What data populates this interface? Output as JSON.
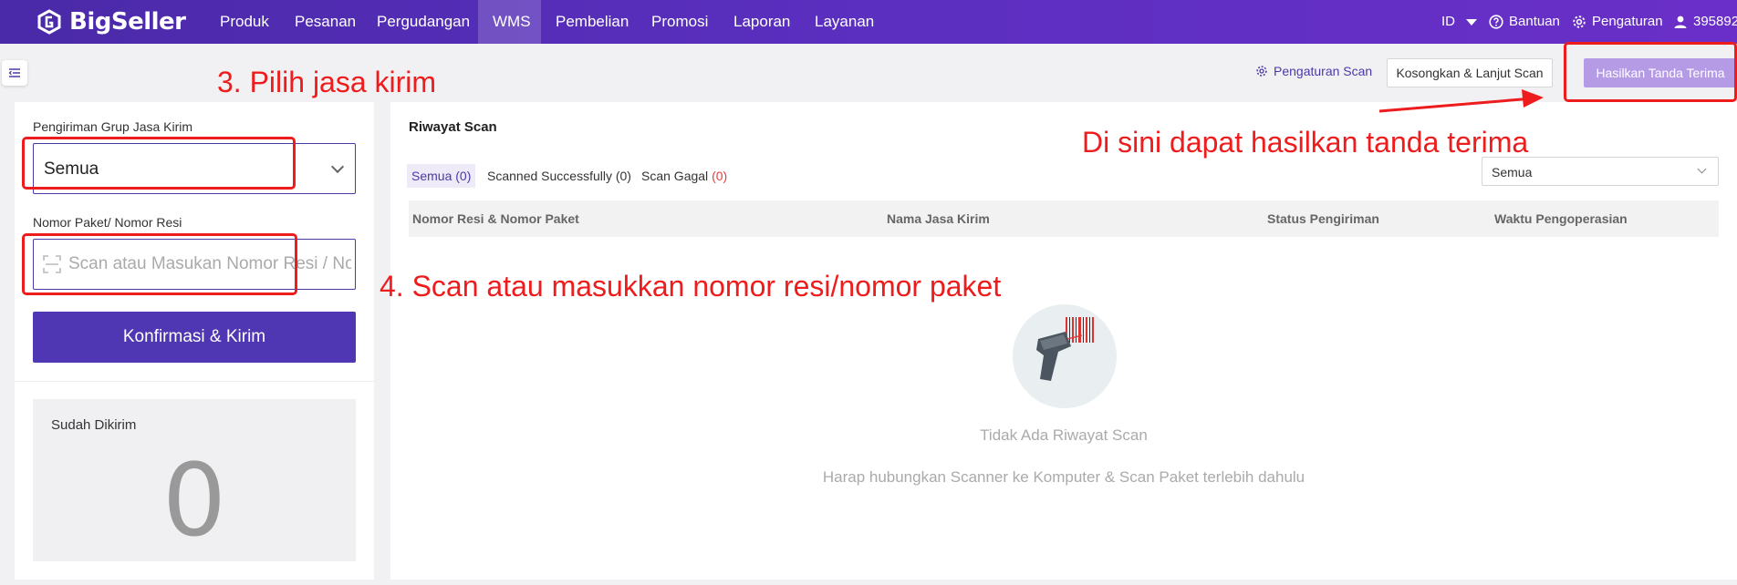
{
  "app": {
    "logo_text": "BigSeller"
  },
  "nav": {
    "items": [
      "Produk",
      "Pesanan",
      "Pergudangan",
      "WMS",
      "Pembelian",
      "Promosi",
      "Laporan",
      "Layanan"
    ],
    "active": "WMS"
  },
  "top_right": {
    "language": "ID",
    "help": "Bantuan",
    "settings": "Pengaturan",
    "user": "395892..."
  },
  "toolbar": {
    "scan_settings": "Pengaturan Scan",
    "clear_continue": "Kosongkan & Lanjut Scan",
    "generate_receipt": "Hasilkan Tanda Terima"
  },
  "left": {
    "carrier_group_label": "Pengiriman Grup Jasa Kirim",
    "carrier_group_value": "Semua",
    "package_label": "Nomor Paket/ Nomor Resi",
    "package_placeholder": "Scan atau Masukan Nomor Resi / Nomor Paket",
    "confirm_button": "Konfirmasi & Kirim",
    "sent_label": "Sudah Dikirim",
    "sent_count": "0"
  },
  "history": {
    "title": "Riwayat Scan",
    "tabs": [
      {
        "label": "Semua",
        "count": "(0)"
      },
      {
        "label": "Scanned Successfully",
        "count": "(0)"
      },
      {
        "label": "Scan Gagal",
        "count": "(0)"
      }
    ],
    "filter_value": "Semua",
    "columns": [
      "Nomor Resi & Nomor Paket",
      "Nama Jasa Kirim",
      "Status Pengiriman",
      "Waktu Pengoperasian"
    ],
    "empty_title": "Tidak Ada Riwayat Scan",
    "empty_subtitle": "Harap hubungkan Scanner ke Komputer & Scan Paket terlebih dahulu"
  },
  "annotations": {
    "step3": "3. Pilih jasa kirim",
    "step4": "4. Scan atau masukkan nomor resi/nomor paket",
    "receipt_note": "Di sini dapat hasilkan tanda terima"
  },
  "colors": {
    "brand": "#5b2fc0",
    "primary_button": "#4f36b3",
    "annotation_red": "#ee1c1c"
  }
}
